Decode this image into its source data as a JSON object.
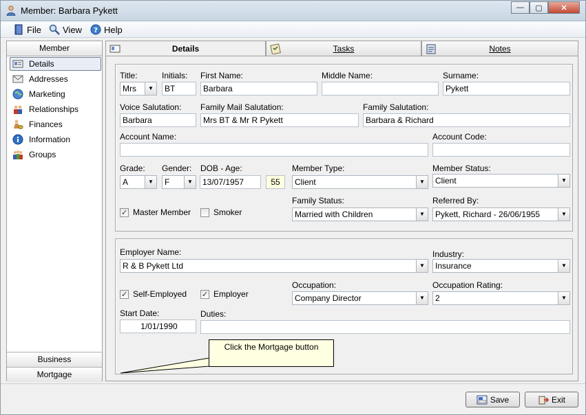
{
  "window": {
    "title": "Member: Barbara Pykett",
    "controls": {
      "minimize": "—",
      "maximize": "▢",
      "close": "✕"
    }
  },
  "menu": {
    "file": "File",
    "view": "View",
    "help": "Help"
  },
  "sidebar": {
    "header": "Member",
    "items": [
      {
        "label": "Details",
        "icon": "card-icon"
      },
      {
        "label": "Addresses",
        "icon": "envelope-icon"
      },
      {
        "label": "Marketing",
        "icon": "globe-icon"
      },
      {
        "label": "Relationships",
        "icon": "people-icon"
      },
      {
        "label": "Finances",
        "icon": "money-icon"
      },
      {
        "label": "Information",
        "icon": "info-icon"
      },
      {
        "label": "Groups",
        "icon": "group-icon"
      }
    ],
    "footer": [
      "Business",
      "Mortgage"
    ]
  },
  "tabs": [
    "Details",
    "Tasks",
    "Notes"
  ],
  "form": {
    "labels": {
      "title": "Title:",
      "initials": "Initials:",
      "first_name": "First Name:",
      "middle_name": "Middle Name:",
      "surname": "Surname:",
      "voice_salutation": "Voice Salutation:",
      "family_mail_salutation": "Family Mail Salutation:",
      "family_salutation": "Family Salutation:",
      "account_name": "Account Name:",
      "account_code": "Account Code:",
      "grade": "Grade:",
      "gender": "Gender:",
      "dob_age": "DOB - Age:",
      "member_type": "Member Type:",
      "member_status": "Member Status:",
      "master_member": "Master Member",
      "smoker": "Smoker",
      "family_status": "Family Status:",
      "referred_by": "Referred By:",
      "employer_name": "Employer Name:",
      "industry": "Industry:",
      "self_employed": "Self-Employed",
      "employer": "Employer",
      "occupation": "Occupation:",
      "occupation_rating": "Occupation Rating:",
      "start_date": "Start Date:",
      "duties": "Duties:"
    },
    "values": {
      "title": "Mrs",
      "initials": "BT",
      "first_name": "Barbara",
      "middle_name": "",
      "surname": "Pykett",
      "voice_salutation": "Barbara",
      "family_mail_salutation": "Mrs BT & Mr R Pykett",
      "family_salutation": "Barbara & Richard",
      "account_name": "",
      "account_code": "",
      "grade": "A",
      "gender": "F",
      "dob": "13/07/1957",
      "age": "55",
      "member_type": "Client",
      "member_status": "Client",
      "family_status": "Married with Children",
      "referred_by": "Pykett, Richard - 26/06/1955",
      "employer_name": "R & B Pykett Ltd",
      "industry": "Insurance",
      "occupation": "Company Director",
      "occupation_rating": "2",
      "start_date": "1/01/1990",
      "duties": ""
    },
    "checks": {
      "master_member": true,
      "smoker": false,
      "self_employed": true,
      "employer": true
    }
  },
  "tooltip": "Click the Mortgage button",
  "buttons": {
    "save": "Save",
    "exit": "Exit"
  },
  "check_glyph": "✓",
  "dropdown_glyph": "▼"
}
